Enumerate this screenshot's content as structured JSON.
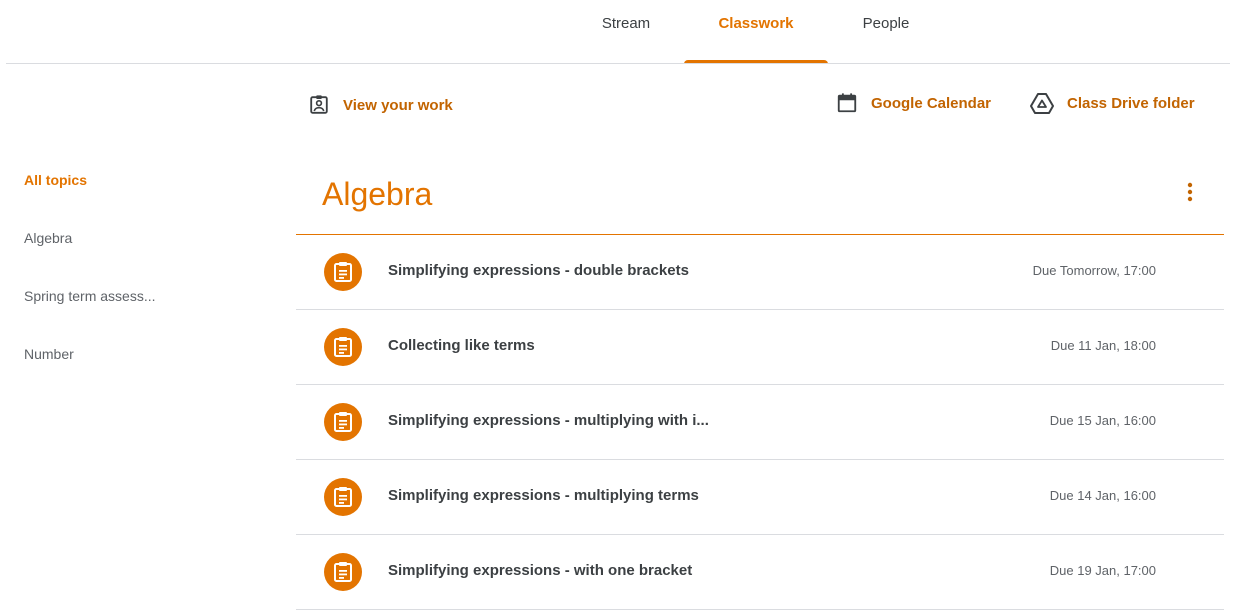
{
  "tabs": [
    {
      "label": "Stream",
      "active": false
    },
    {
      "label": "Classwork",
      "active": true
    },
    {
      "label": "People",
      "active": false
    }
  ],
  "actions": {
    "view_work": "View your work",
    "calendar": "Google Calendar",
    "drive": "Class Drive folder"
  },
  "topics": [
    {
      "label": "All topics",
      "active": true
    },
    {
      "label": "Algebra",
      "active": false
    },
    {
      "label": "Spring term assess...",
      "active": false
    },
    {
      "label": "Number",
      "active": false
    }
  ],
  "section": {
    "title": "Algebra",
    "items": [
      {
        "title": "Simplifying expressions - double brackets",
        "due": "Due Tomorrow, 17:00"
      },
      {
        "title": "Collecting like terms",
        "due": "Due 11 Jan, 18:00"
      },
      {
        "title": "Simplifying expressions - multiplying with i...",
        "due": "Due 15 Jan, 16:00"
      },
      {
        "title": "Simplifying expressions - multiplying terms",
        "due": "Due 14 Jan, 16:00"
      },
      {
        "title": "Simplifying expressions - with one bracket",
        "due": "Due 19 Jan, 17:00"
      }
    ]
  },
  "icons": {
    "view_work": "assignment-ind-icon",
    "calendar": "calendar-icon",
    "drive": "google-drive-icon",
    "more": "more-vert-icon",
    "assignment": "assignment-icon"
  },
  "colors": {
    "accent": "#e37400",
    "accent_text": "#c26401",
    "divider": "#dadce0",
    "text": "#3c4043",
    "muted": "#5f6368"
  }
}
